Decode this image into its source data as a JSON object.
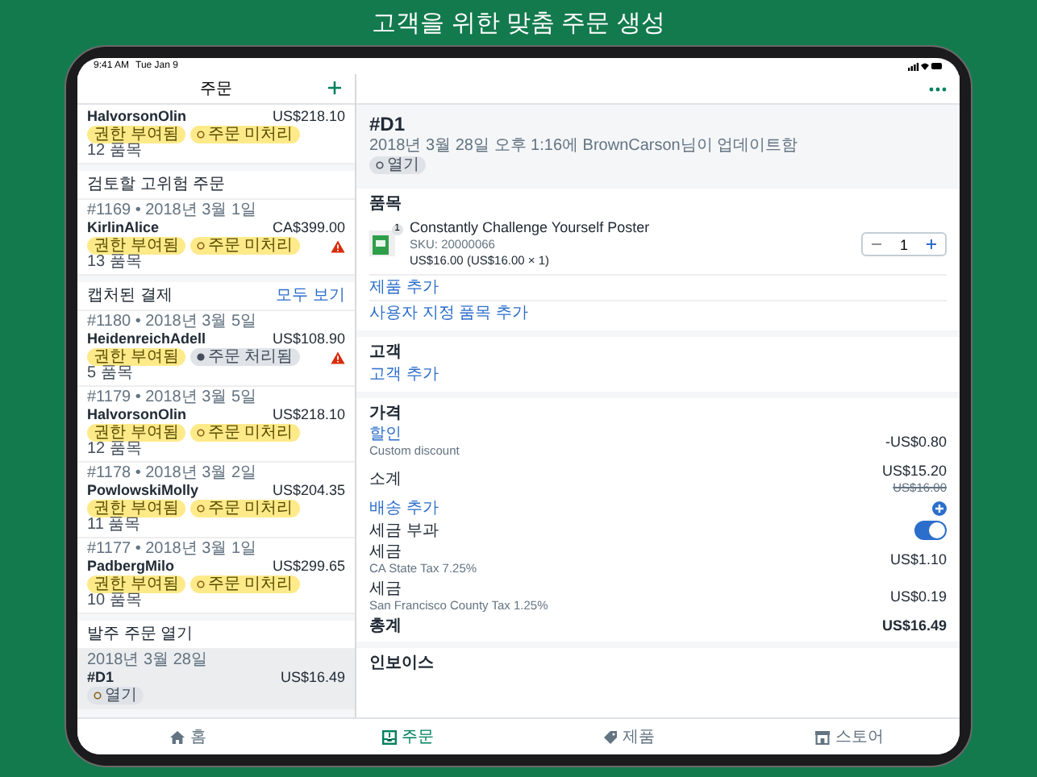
{
  "page_title": "고객을 위한 맞춤 주문 생성",
  "status_bar": {
    "time": "9:41 AM",
    "date": "Tue Jan 9"
  },
  "sidebar": {
    "title": "주문",
    "sections": [
      {
        "items": [
          {
            "name": "HalvorsonOlin",
            "total": "US$218.10",
            "badges": [
              {
                "label": "권한 부여됨",
                "kind": "payment"
              },
              {
                "label": "주문 미처리",
                "kind": "unfulfilled"
              }
            ],
            "count": "12 품목",
            "warning": false,
            "selected": false
          }
        ]
      },
      {
        "heading": "검토할 고위험 주문",
        "items": [
          {
            "meta": "#1169 • 2018년 3월 1일",
            "name": "KirlinAlice",
            "total": "CA$399.00",
            "badges": [
              {
                "label": "권한 부여됨",
                "kind": "payment"
              },
              {
                "label": "주문 미처리",
                "kind": "unfulfilled"
              }
            ],
            "count": "13 품목",
            "warning": true,
            "selected": false
          }
        ]
      },
      {
        "heading": "캡처된 결제",
        "action": "모두 보기",
        "items": [
          {
            "meta": "#1180 • 2018년 3월 5일",
            "name": "HeidenreichAdell",
            "total": "US$108.90",
            "badges": [
              {
                "label": "권한 부여됨",
                "kind": "payment"
              },
              {
                "label": "주문 처리됨",
                "kind": "fulfilled"
              }
            ],
            "count": "5 품목",
            "warning": true,
            "selected": false
          },
          {
            "meta": "#1179 • 2018년 3월 5일",
            "name": "HalvorsonOlin",
            "total": "US$218.10",
            "badges": [
              {
                "label": "권한 부여됨",
                "kind": "payment"
              },
              {
                "label": "주문 미처리",
                "kind": "unfulfilled"
              }
            ],
            "count": "12 품목",
            "warning": false,
            "selected": false
          },
          {
            "meta": "#1178 • 2018년 3월 2일",
            "name": "PowlowskiMolly",
            "total": "US$204.35",
            "badges": [
              {
                "label": "권한 부여됨",
                "kind": "payment"
              },
              {
                "label": "주문 미처리",
                "kind": "unfulfilled"
              }
            ],
            "count": "11 품목",
            "warning": false,
            "selected": false
          },
          {
            "meta": "#1177 • 2018년 3월 1일",
            "name": "PadbergMilo",
            "total": "US$299.65",
            "badges": [
              {
                "label": "권한 부여됨",
                "kind": "payment"
              },
              {
                "label": "주문 미처리",
                "kind": "unfulfilled"
              }
            ],
            "count": "10 품목",
            "warning": false,
            "selected": false
          }
        ]
      },
      {
        "heading": "발주 주문 열기",
        "items": [
          {
            "meta": "2018년 3월 28일",
            "name": "#D1",
            "total": "US$16.49",
            "badges": [
              {
                "label": "열기",
                "kind": "open"
              }
            ],
            "warning": false,
            "selected": true
          }
        ]
      }
    ]
  },
  "detail": {
    "title": "#D1",
    "meta": "2018년 3월 28일 오후 1:16에 BrownCarson님이 업데이트함",
    "badge": {
      "label": "열기",
      "kind": "open"
    },
    "items_section": {
      "heading": "품목",
      "line_items": [
        {
          "name": "Constantly Challenge Yourself Poster",
          "sku": "SKU: 20000066",
          "price": "US$16.00 (US$16.00 × 1)",
          "image_badge": "1",
          "quantity": "1"
        }
      ],
      "links": [
        "제품 추가",
        "사용자 지정 품목 추가"
      ]
    },
    "customer_section": {
      "heading": "고객",
      "links": [
        "고객 추가"
      ]
    },
    "pricing": {
      "heading": "가격",
      "rows": [
        {
          "kind": "discount",
          "label": "할인",
          "sublabel": "Custom discount",
          "value": "-US$0.80"
        },
        {
          "kind": "subtotal",
          "label": "소계",
          "value": "US$15.20",
          "original_value": "US$16.00"
        },
        {
          "kind": "link",
          "label": "배송 추가"
        },
        {
          "kind": "toggle",
          "label": "세금 부과",
          "on": true
        },
        {
          "kind": "tax",
          "label": "세금",
          "sublabel": "CA State Tax 7.25%",
          "value": "US$1.10"
        },
        {
          "kind": "tax",
          "label": "세금",
          "sublabel": "San Francisco County Tax 1.25%",
          "value": "US$0.19"
        },
        {
          "kind": "total",
          "label": "총계",
          "value": "US$16.49"
        }
      ]
    },
    "next_section": {
      "heading": "인보이스"
    }
  },
  "tabs": [
    {
      "label": "홈",
      "selected": false
    },
    {
      "label": "주문",
      "selected": true
    },
    {
      "label": "제품",
      "selected": false
    },
    {
      "label": "스토어",
      "selected": false
    }
  ]
}
